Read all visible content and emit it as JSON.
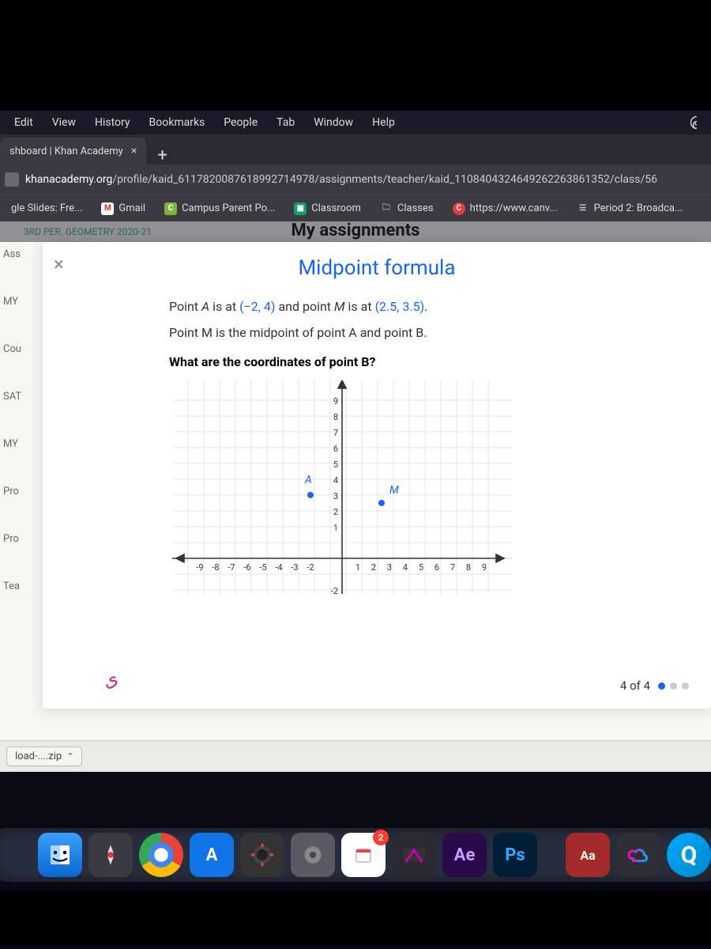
{
  "mac_menu": [
    "Edit",
    "View",
    "History",
    "Bookmarks",
    "People",
    "Tab",
    "Window",
    "Help"
  ],
  "tab": {
    "title": "shboard | Khan Academy"
  },
  "url": {
    "domain": "khanacademy.org",
    "path": "/profile/kaid_6117820087618992714978/assignments/teacher/kaid_1108404324649262263861352/class/56"
  },
  "bookmarks": {
    "b0": "gle Slides: Fre...",
    "b1": "Gmail",
    "b2": "Campus Parent Po...",
    "b3": "Classroom",
    "b4": "Classes",
    "b5": "https://www.canv...",
    "b6": "Period 2: Broadca..."
  },
  "ka_strip": {
    "class": "3RD PER. GEOMETRY 2020-21",
    "heading": "My assignments"
  },
  "left_frags": {
    "f0": "Ass",
    "f1": "MY",
    "f2": "Cou",
    "f3": "SAT",
    "f4": "MY",
    "f5": "Pro",
    "f6": "Pro",
    "f7": "Tea"
  },
  "modal": {
    "title": "Midpoint formula",
    "line1_a": "Point ",
    "line1_b": " is at ",
    "line1_c": " and point ",
    "line1_d": " is at ",
    "A_label": "A",
    "A_coord": "(−2, 4)",
    "M_label": "M",
    "M_coord": "(2.5, 3.5)",
    "period": ".",
    "line2": "Point M is the midpoint of point A and point B.",
    "question": "What are the coordinates of point B?",
    "progress": "4 of 4"
  },
  "graph": {
    "x_neg": [
      "-9",
      "-8",
      "-7",
      "-6",
      "-5",
      "-4",
      "-3",
      "-2"
    ],
    "x_pos": [
      "1",
      "2",
      "3",
      "4",
      "5",
      "6",
      "7",
      "8",
      "9"
    ],
    "y_pos": [
      "9",
      "8",
      "7",
      "6",
      "5",
      "4",
      "3",
      "2",
      "1"
    ],
    "y_neg": "-2",
    "A_label": "A",
    "M_label": "M"
  },
  "download": {
    "name": "load-....zip"
  },
  "dock": {
    "ae": "Ae",
    "ps": "Ps",
    "aa": "Aa",
    "A": "A",
    "badge": "2"
  }
}
